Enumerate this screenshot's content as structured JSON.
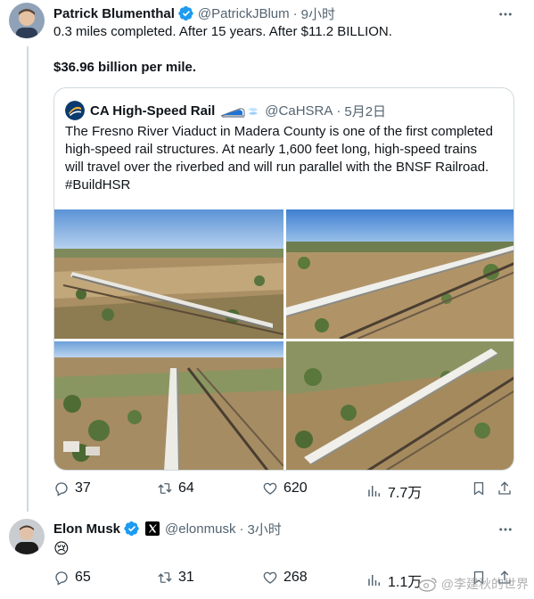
{
  "post1": {
    "author_name": "Patrick Blumenthal",
    "handle": "@PatrickJBlum",
    "separator": "·",
    "time": "9小时",
    "text_line1": "0.3 miles completed. After 15 years. After $11.2 BILLION.",
    "text_line2": "$36.96 billion per mile.",
    "quote": {
      "author_name": "CA High-Speed Rail",
      "handle": "@CaHSRA",
      "separator": "·",
      "time": "5月2日",
      "lines": [
        "The Fresno River Viaduct in Madera County is one of the first completed",
        "high-speed rail structures. At nearly 1,600 feet long, high-speed trains",
        "will travel over the riverbed and will run parallel with the BNSF Railroad.",
        "#BuildHSR"
      ]
    },
    "actions": {
      "replies": "37",
      "reposts": "64",
      "likes": "620",
      "views": "7.7万"
    }
  },
  "post2": {
    "author_name": "Elon Musk",
    "handle": "@elonmusk",
    "separator": "·",
    "time": "3小时",
    "text": "😢",
    "actions": {
      "replies": "65",
      "reposts": "31",
      "likes": "268",
      "views": "1.1万"
    }
  },
  "watermark": "@李建秋的世界",
  "colors": {
    "text": "#0f1419",
    "secondary": "#536471",
    "border": "#cfd9de",
    "verified_blue": "#1d9bf0"
  },
  "icons": [
    "verified-badge-icon",
    "more-icon",
    "reply-icon",
    "repost-icon",
    "like-icon",
    "views-icon",
    "bookmark-icon",
    "share-icon",
    "x-logo-icon",
    "weibo-icon"
  ]
}
